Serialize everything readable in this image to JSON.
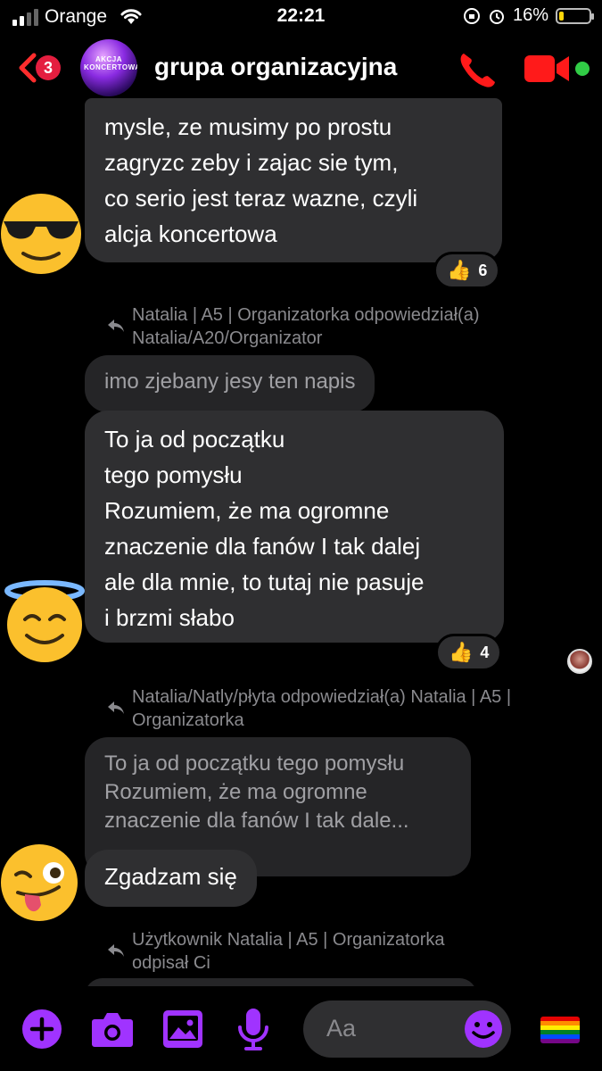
{
  "status_bar": {
    "carrier": "Orange",
    "time": "22:21",
    "battery_pct": "16%",
    "battery_level": 0.16
  },
  "header": {
    "back_badge": "3",
    "group_name": "grupa organizacyjna",
    "avatar_text": "AKCJA KONCERTOWA"
  },
  "messages": [
    {
      "text": "mysle, ze musimy po prostu\nzagryzc zeby i zajac sie tym,\nco serio jest teraz wazne, czyli\nalcja koncertowa",
      "reaction_icon": "thumbs-up",
      "reaction_count": "6",
      "avatar": "sunglasses-face-emoji"
    },
    {
      "reply_header": "Natalia | A5 | Organizatorka odpowiedział(a)\nNatalia/A20/Organizator",
      "quoted": "imo zjebany jesy ten napis",
      "text": "To ja od początku\ntego pomysłu\nRozumiem, że ma ogromne\nznaczenie dla fanów I tak dalej\nale dla mnie, to tutaj nie pasuje\ni brzmi słabo",
      "reaction_icon": "thumbs-up",
      "reaction_count": "4",
      "avatar": "halo-face-emoji"
    },
    {
      "reply_header": "Natalia/Natly/płyta odpowiedział(a) Natalia | A5 |\nOrganizatorka",
      "quoted": "To ja od początku tego pomysłu\nRozumiem, że ma ogromne\nznaczenie dla fanów I tak dale...",
      "text": "Zgadzam się",
      "avatar": "winking-tongue-emoji"
    },
    {
      "reply_header": "Użytkownik Natalia | A5 | Organizatorka\nodpisał Ci"
    }
  ],
  "composer": {
    "placeholder": "Aa",
    "icons": [
      "plus-icon",
      "camera-icon",
      "gallery-icon",
      "microphone-icon",
      "emoji-icon",
      "rainbow-flag-icon"
    ]
  },
  "colors": {
    "accent": "#a033ff",
    "call_red": "#ff1a1a",
    "bubble": "#2f2f31",
    "online": "#31cc46"
  }
}
